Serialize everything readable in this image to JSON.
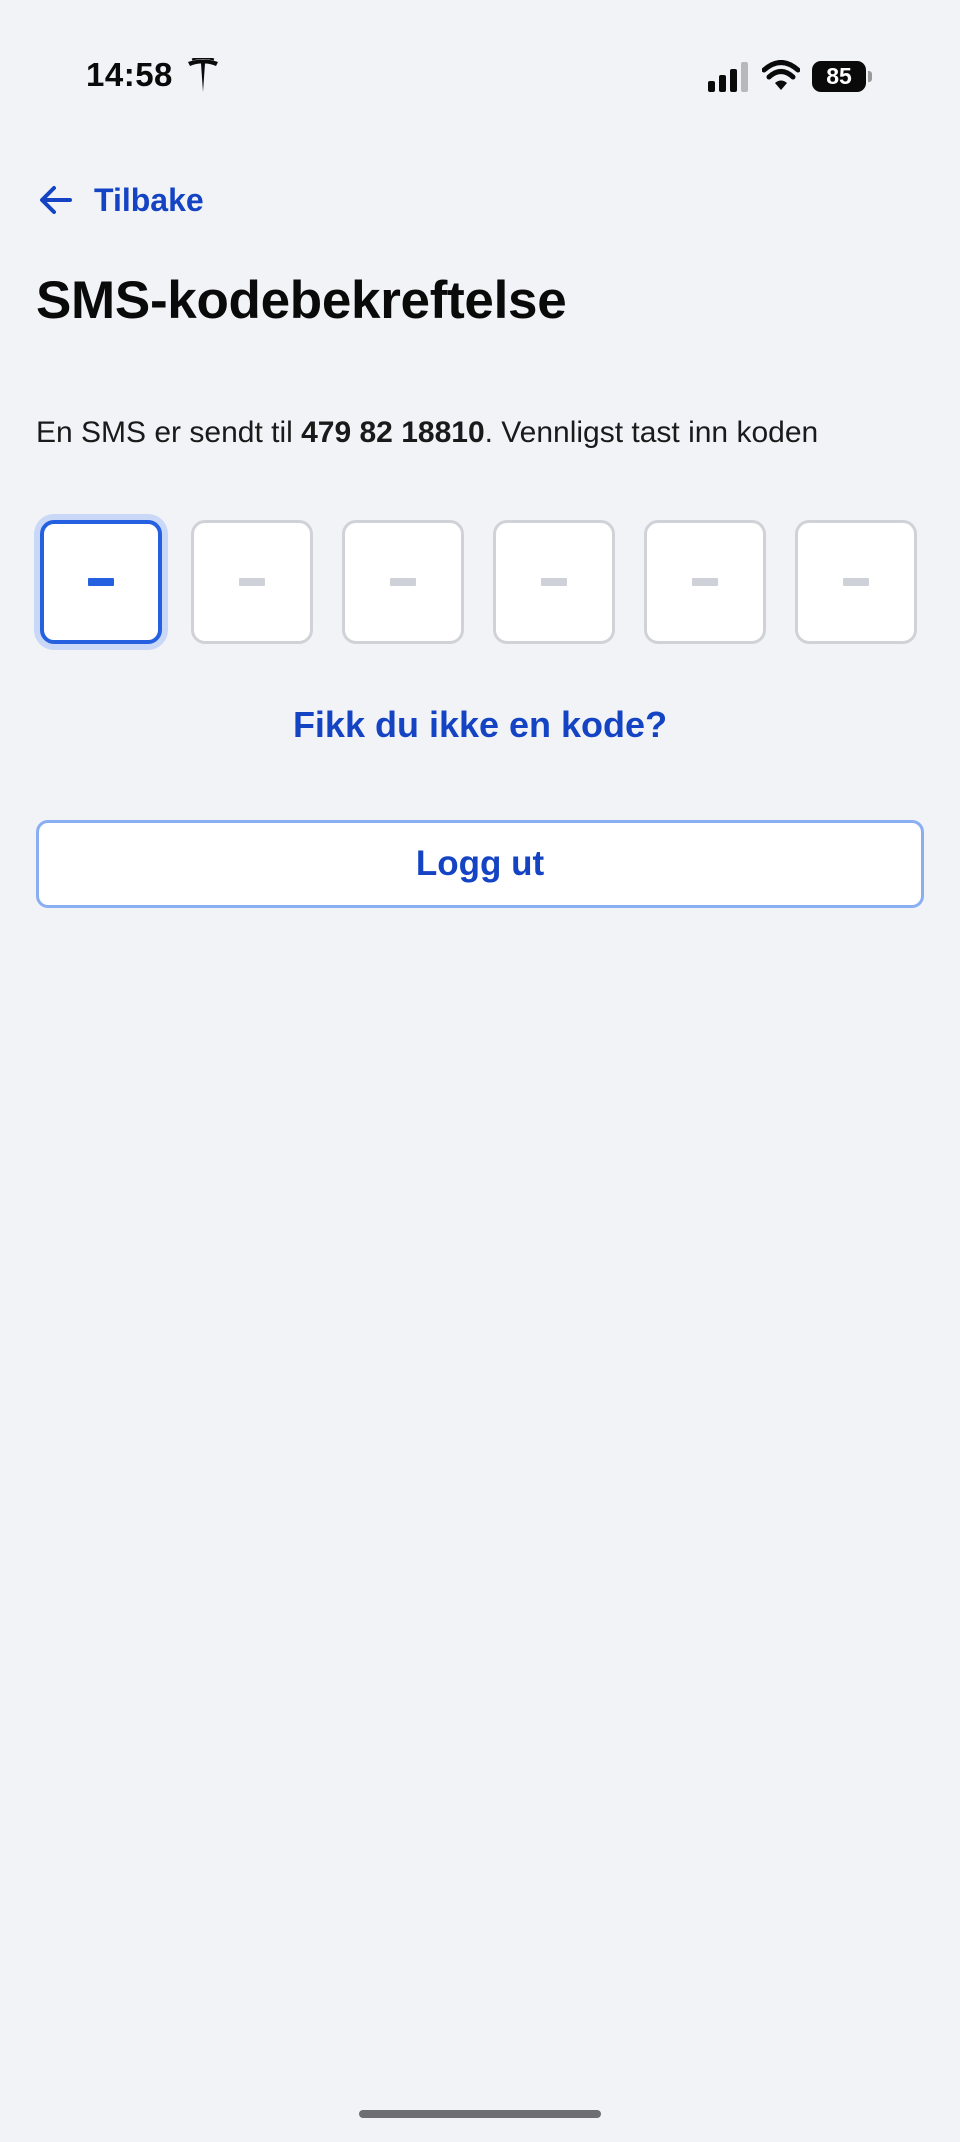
{
  "status_bar": {
    "time": "14:58",
    "battery_level": "85",
    "brand_icon": "tesla-logo-icon",
    "signal_icon": "cellular-signal-icon",
    "wifi_icon": "wifi-icon"
  },
  "nav": {
    "back_label": "Tilbake",
    "back_icon": "arrow-left-icon"
  },
  "page": {
    "title": "SMS-kodebekreftelse",
    "instruction_prefix": "En SMS er sendt til ",
    "phone_number": "479 82 18810",
    "instruction_suffix": ". Vennligst tast inn koden"
  },
  "code_input": {
    "digit_count": 6,
    "active_index": 0,
    "placeholder": "-"
  },
  "actions": {
    "resend_label": "Fikk du ikke en kode?",
    "logout_label": "Logg ut"
  },
  "colors": {
    "accent": "#1444c4",
    "active_border": "#2460e0",
    "background": "#f2f3f7"
  }
}
